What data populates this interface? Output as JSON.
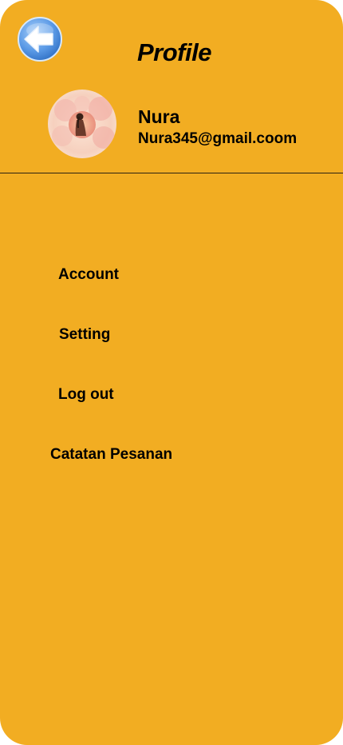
{
  "header": {
    "title": "Profile",
    "back_icon": "back-arrow-icon"
  },
  "profile": {
    "avatar_icon": "profile-photo",
    "name": "Nura",
    "email": "Nura345@gmail.coom"
  },
  "menu": {
    "items": [
      {
        "label": "Account"
      },
      {
        "label": "Setting"
      },
      {
        "label": "Log out"
      },
      {
        "label": "Catatan Pesanan"
      }
    ]
  },
  "colors": {
    "background": "#f2ad22",
    "text": "#000000",
    "back_button": "#5b9ae6"
  }
}
